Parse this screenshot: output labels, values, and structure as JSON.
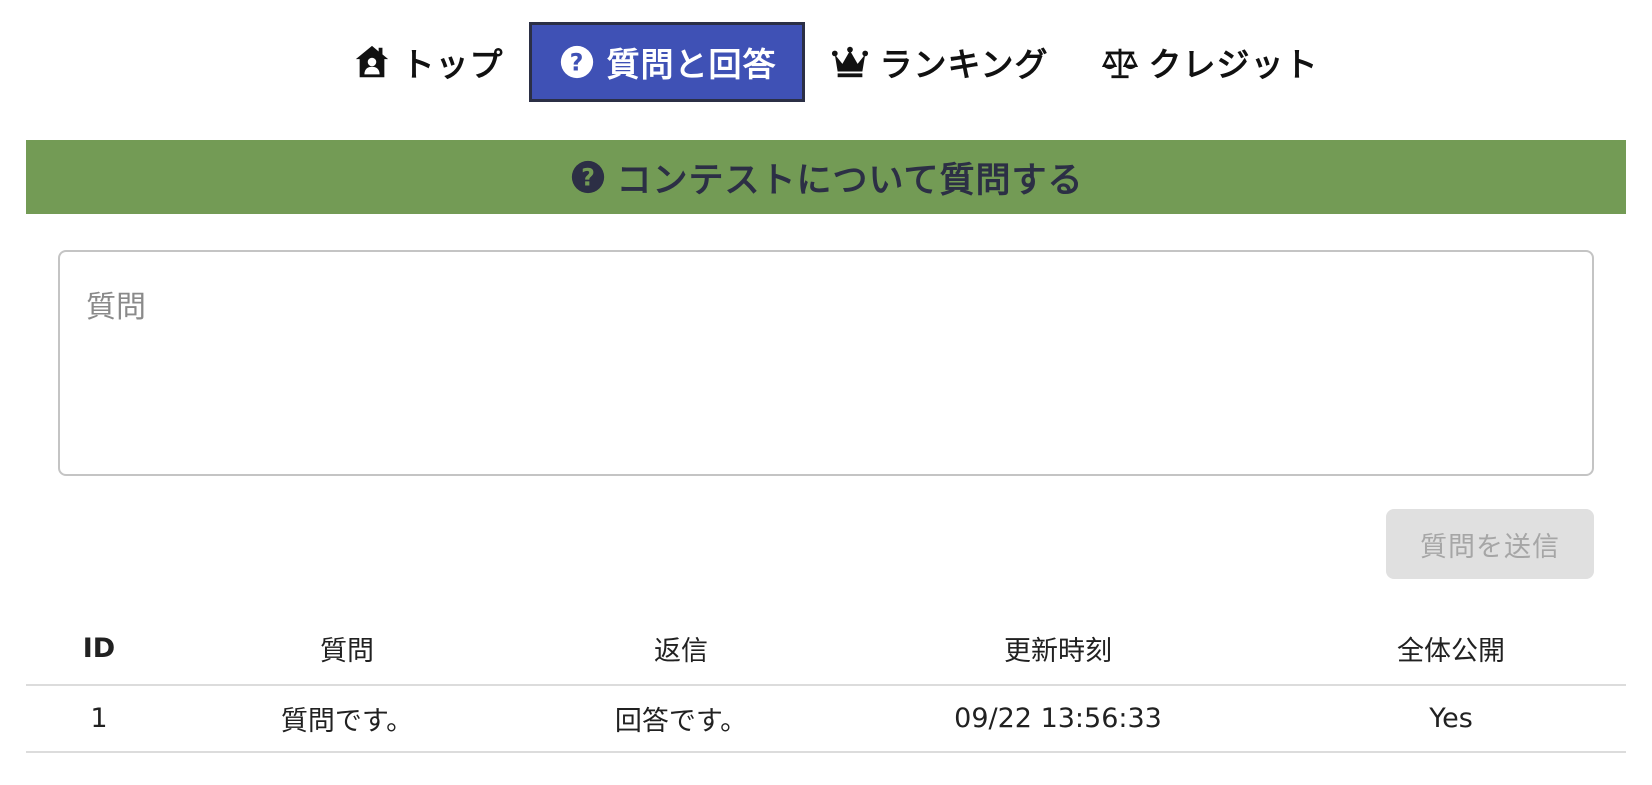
{
  "nav": {
    "tabs": [
      {
        "label": "トップ",
        "icon": "house-user-icon",
        "active": false
      },
      {
        "label": "質問と回答",
        "icon": "question-circle-icon",
        "active": true
      },
      {
        "label": "ランキング",
        "icon": "crown-icon",
        "active": false
      },
      {
        "label": "クレジット",
        "icon": "balance-scale-icon",
        "active": false
      }
    ]
  },
  "section": {
    "title": "コンテストについて質問する",
    "icon": "question-circle-icon"
  },
  "form": {
    "question_placeholder": "質問",
    "submit_label": "質問を送信"
  },
  "table": {
    "headers": [
      "ID",
      "質問",
      "返信",
      "更新時刻",
      "全体公開"
    ],
    "rows": [
      [
        "1",
        "質問です。",
        "回答です。",
        "09/22 13:56:33",
        "Yes"
      ]
    ]
  },
  "colors": {
    "active_tab": "#3f51b5",
    "header_band": "#739b55",
    "header_text": "#2c2f45",
    "button_disabled": "#e0e0e0"
  }
}
